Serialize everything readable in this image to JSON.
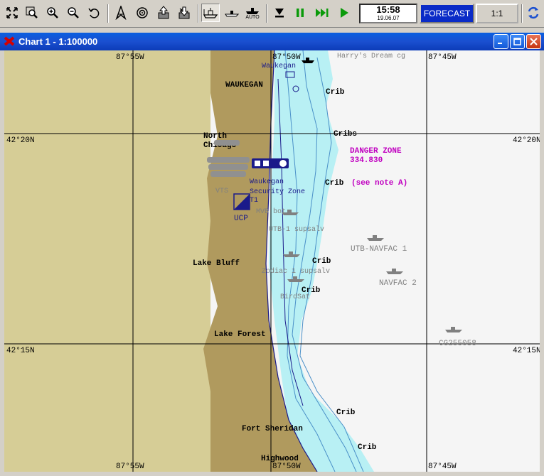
{
  "toolbar": {
    "buttons": [
      {
        "id": "fit-all",
        "icon": "fit-all-icon"
      },
      {
        "id": "zoom-window",
        "icon": "zoom-window-icon"
      },
      {
        "id": "zoom-in",
        "icon": "zoom-in-icon"
      },
      {
        "id": "zoom-out",
        "icon": "zoom-out-icon"
      },
      {
        "id": "undo-view",
        "icon": "undo-icon"
      },
      {
        "id": "north-up",
        "icon": "north-arrow-icon"
      },
      {
        "id": "center-vessel",
        "icon": "target-icon"
      },
      {
        "id": "export",
        "icon": "export-icon"
      },
      {
        "id": "import",
        "icon": "import-icon"
      },
      {
        "id": "ship-mode",
        "icon": "ship-mode-icon"
      },
      {
        "id": "ship-track",
        "icon": "ship-track-icon"
      },
      {
        "id": "auto",
        "icon": "auto-icon",
        "label": "AUTO"
      },
      {
        "id": "record",
        "icon": "down-arrow-icon"
      },
      {
        "id": "pause",
        "icon": "pause-icon"
      },
      {
        "id": "fast-forward",
        "icon": "fast-forward-icon"
      },
      {
        "id": "play",
        "icon": "play-icon"
      },
      {
        "id": "sync",
        "icon": "sync-icon"
      }
    ],
    "clock": {
      "time": "15:58",
      "date": "19.06.07"
    },
    "forecast_label": "FORECAST",
    "scale_label": "1:1"
  },
  "window": {
    "title": "Chart 1 - 1:100000"
  },
  "map": {
    "grid_labels": {
      "lon_top_left": "87°55W",
      "lon_top_mid": "87°50W",
      "lon_top_right": "87°45W",
      "lon_bottom_left": "87°55W",
      "lon_bottom_mid": "87°50W",
      "lon_bottom_right": "87°45W",
      "lat_upper_left": "42°20N",
      "lat_upper_right": "42°20N",
      "lat_lower_left": "42°15N",
      "lat_lower_right": "42°15N"
    },
    "places": {
      "waukegan": "WAUKEGAN",
      "north": "North",
      "chicago": "Chicago",
      "lake_bluff": "Lake Bluff",
      "lake_forest": "Lake Forest",
      "fort_sheridan": "Fort Sheridan",
      "highwood": "Highwood"
    },
    "cribs": [
      "Crib",
      "Cribs",
      "Crib",
      "Crib",
      "Crib",
      "Crib",
      "Crib"
    ],
    "danger_zone": {
      "line1": "DANGER ZONE",
      "line2": "334.830",
      "note": "(see note A)"
    },
    "vessels": {
      "harrys": "Harry's Dream cg",
      "waukegan_tag": "Waukegan",
      "utb": "UTB-NAVFAC 1",
      "navfac2": "NAVFAC 2",
      "cg": "CG255058",
      "ucp": "UCP",
      "t1": "T1",
      "security_zone": "Security Zone",
      "mvb": "MVB bot",
      "utb1": "UTB-1 supsalv",
      "zodiac": "Zodiac 1 supsalv",
      "bird": "BirdSat",
      "vts": "VTS",
      "waukegan_lbl": "Waukegan"
    },
    "colors": {
      "land": "#b09a5e",
      "land_light": "#d6cd96",
      "shallow": "#b8f0f4",
      "deep": "#f5f5f5",
      "danger": "#c000c0",
      "grid": "#000000"
    }
  }
}
